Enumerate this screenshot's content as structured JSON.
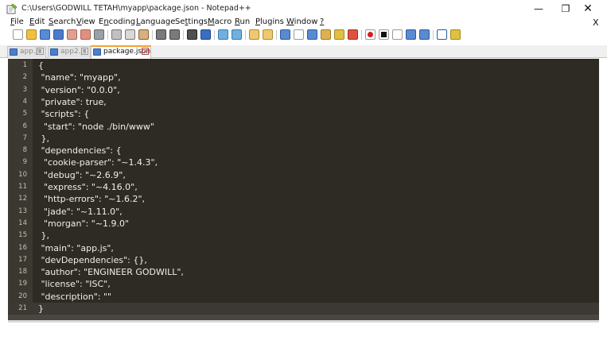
{
  "window": {
    "title": "C:\\Users\\GODWILL TETAH\\myapp\\package.json - Notepad++",
    "minimize_glyph": "—",
    "maximize_glyph": "❐",
    "close_glyph": "✕",
    "doc_close_glyph": "X"
  },
  "menu": [
    {
      "u": "F",
      "rest": "ile"
    },
    {
      "u": "E",
      "rest": "dit"
    },
    {
      "u": "S",
      "rest": "earch"
    },
    {
      "u": "V",
      "rest": "iew"
    },
    {
      "pre": "E",
      "u": "n",
      "rest": "coding"
    },
    {
      "u": "L",
      "rest": "anguage"
    },
    {
      "pre": "Se",
      "u": "t",
      "rest": "tings"
    },
    {
      "u": "M",
      "rest": "acro"
    },
    {
      "u": "R",
      "rest": "un"
    },
    {
      "u": "P",
      "rest": "lugins"
    },
    {
      "u": "W",
      "rest": "indow"
    },
    {
      "u": "?",
      "rest": ""
    }
  ],
  "tabs": [
    {
      "label": "app.js",
      "active": false
    },
    {
      "label": "app2.js",
      "active": false
    },
    {
      "label": "package.json",
      "active": true
    }
  ],
  "tab_close_glyph": "x",
  "editor": {
    "colors": {
      "background": "#2e2a24",
      "gutter": "#3b3832",
      "text": "#f2efe8",
      "tab_accent": "#f4a12c"
    },
    "lines": [
      {
        "n": "1",
        "text": "{"
      },
      {
        "n": "2",
        "text": " \"name\": \"myapp\","
      },
      {
        "n": "3",
        "text": " \"version\": \"0.0.0\","
      },
      {
        "n": "4",
        "text": " \"private\": true,"
      },
      {
        "n": "5",
        "text": " \"scripts\": {"
      },
      {
        "n": "6",
        "text": "  \"start\": \"node ./bin/www\""
      },
      {
        "n": "7",
        "text": " },"
      },
      {
        "n": "8",
        "text": " \"dependencies\": {"
      },
      {
        "n": "9",
        "text": "  \"cookie-parser\": \"~1.4.3\","
      },
      {
        "n": "10",
        "text": "  \"debug\": \"~2.6.9\","
      },
      {
        "n": "11",
        "text": "  \"express\": \"~4.16.0\","
      },
      {
        "n": "12",
        "text": "  \"http-errors\": \"~1.6.2\","
      },
      {
        "n": "13",
        "text": "  \"jade\": \"~1.11.0\","
      },
      {
        "n": "14",
        "text": "  \"morgan\": \"~1.9.0\""
      },
      {
        "n": "15",
        "text": " },"
      },
      {
        "n": "16",
        "text": " \"main\": \"app.js\","
      },
      {
        "n": "17",
        "text": " \"devDependencies\": {},"
      },
      {
        "n": "18",
        "text": " \"author\": \"ENGINEER GODWILL\","
      },
      {
        "n": "19",
        "text": " \"license\": \"ISC\","
      },
      {
        "n": "20",
        "text": " \"description\": \"\""
      },
      {
        "n": "21",
        "text": "}"
      }
    ]
  }
}
